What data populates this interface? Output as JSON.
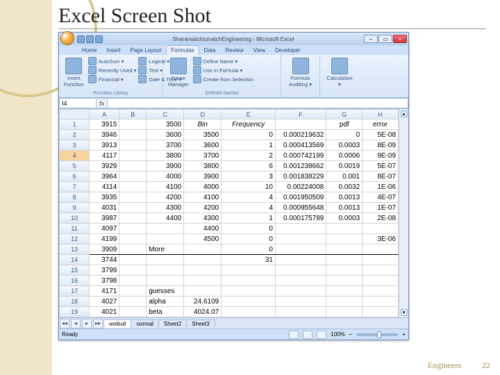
{
  "slide": {
    "title": "Excel Screen Shot",
    "footer_text": "Engineers",
    "page_number": "22"
  },
  "window": {
    "title": "SharamatchismatchEngineering - Microsoft Excel",
    "qat": [
      "save",
      "undo",
      "redo"
    ],
    "win_min": "–",
    "win_max": "▭",
    "win_close": "×"
  },
  "tabs": [
    "Home",
    "Insert",
    "Page Layout",
    "Formulas",
    "Data",
    "Review",
    "View",
    "Developer"
  ],
  "active_tab": 3,
  "ribbon": {
    "insert_function": "Insert\nFunction",
    "autosum": "AutoSum ▾",
    "recent": "Recently Used ▾",
    "financial": "Financial ▾",
    "logical": "Logical ▾",
    "text": "Text ▾",
    "datetime": "Date & Time ▾",
    "more": "▾",
    "lib_label": "Function Library",
    "name_mgr": "Name\nManager",
    "define": "Define Name ▾",
    "use": "Use in Formula ▾",
    "create": "Create from Selection",
    "names_label": "Defined Names",
    "audit": "Formula\nAuditing ▾",
    "calc": "Calculation\n▾"
  },
  "namebox": "I4",
  "columns": [
    "A",
    "B",
    "C",
    "D",
    "E",
    "F",
    "G",
    "H"
  ],
  "header_row": {
    "D": "Bin",
    "E": "Frequency",
    "G": "pdf",
    "H": "error"
  },
  "rows": [
    {
      "n": 1,
      "A": 3915,
      "C": 3500
    },
    {
      "n": 2,
      "A": 3946,
      "C": 3600,
      "D": 3500,
      "E": 0,
      "F": 0.000219632,
      "G": 0,
      "H": "5E-08"
    },
    {
      "n": 3,
      "A": 3913,
      "C": 3700,
      "D": 3600,
      "E": 1,
      "F": 0.000413569,
      "G": 0.0003,
      "H": "8E-09"
    },
    {
      "n": 4,
      "A": 4117,
      "C": 3800,
      "D": 3700,
      "E": 2,
      "F": 0.000742199,
      "G": 0.0006,
      "H": "9E-09"
    },
    {
      "n": 5,
      "A": 3929,
      "C": 3900,
      "D": 3800,
      "E": 6,
      "F": 0.001238662,
      "G": 0.0019,
      "H": "5E-07"
    },
    {
      "n": 6,
      "A": 3964,
      "C": 4000,
      "D": 3900,
      "E": 3,
      "F": 0.001838229,
      "G": 0.001,
      "H": "8E-07"
    },
    {
      "n": 7,
      "A": 4114,
      "C": 4100,
      "D": 4000,
      "E": 10,
      "F": 0.00224008,
      "G": 0.0032,
      "H": "1E-06"
    },
    {
      "n": 8,
      "A": 3935,
      "C": 4200,
      "D": 4100,
      "E": 4,
      "F": 0.001950509,
      "G": 0.0013,
      "H": "4E-07"
    },
    {
      "n": 9,
      "A": 4031,
      "C": 4300,
      "D": 4200,
      "E": 4,
      "F": 0.000955648,
      "G": 0.0013,
      "H": "1E-07"
    },
    {
      "n": 10,
      "A": 3987,
      "C": 4400,
      "D": 4300,
      "E": 1,
      "F": 0.000175789,
      "G": 0.0003,
      "H": "2E-08"
    },
    {
      "n": 11,
      "A": 4097,
      "D": 4400,
      "E": 0
    },
    {
      "n": 12,
      "A": 4199,
      "D": 4500,
      "E": 0,
      "H": "3E-06"
    },
    {
      "n": 13,
      "A": 3909,
      "C": "More",
      "E": 0,
      "more": true
    },
    {
      "n": 14,
      "A": 3744,
      "E": 31
    },
    {
      "n": 15,
      "A": 3799
    },
    {
      "n": 16,
      "A": 3798
    },
    {
      "n": 17,
      "A": 4171,
      "C": "guesses"
    },
    {
      "n": 18,
      "A": 4027,
      "C": "alpha",
      "D": 24.6109
    },
    {
      "n": 19,
      "A": 4021,
      "C": "beta",
      "D": 4024.07
    }
  ],
  "sheets": {
    "nav": [
      "◂◂",
      "◂",
      "▸",
      "▸▸"
    ],
    "tabs": [
      "weibull",
      "normal",
      "Sheet2",
      "Sheet3"
    ],
    "active": 0
  },
  "status": {
    "ready": "Ready",
    "zoom": "100%",
    "minus": "–",
    "plus": "+"
  }
}
